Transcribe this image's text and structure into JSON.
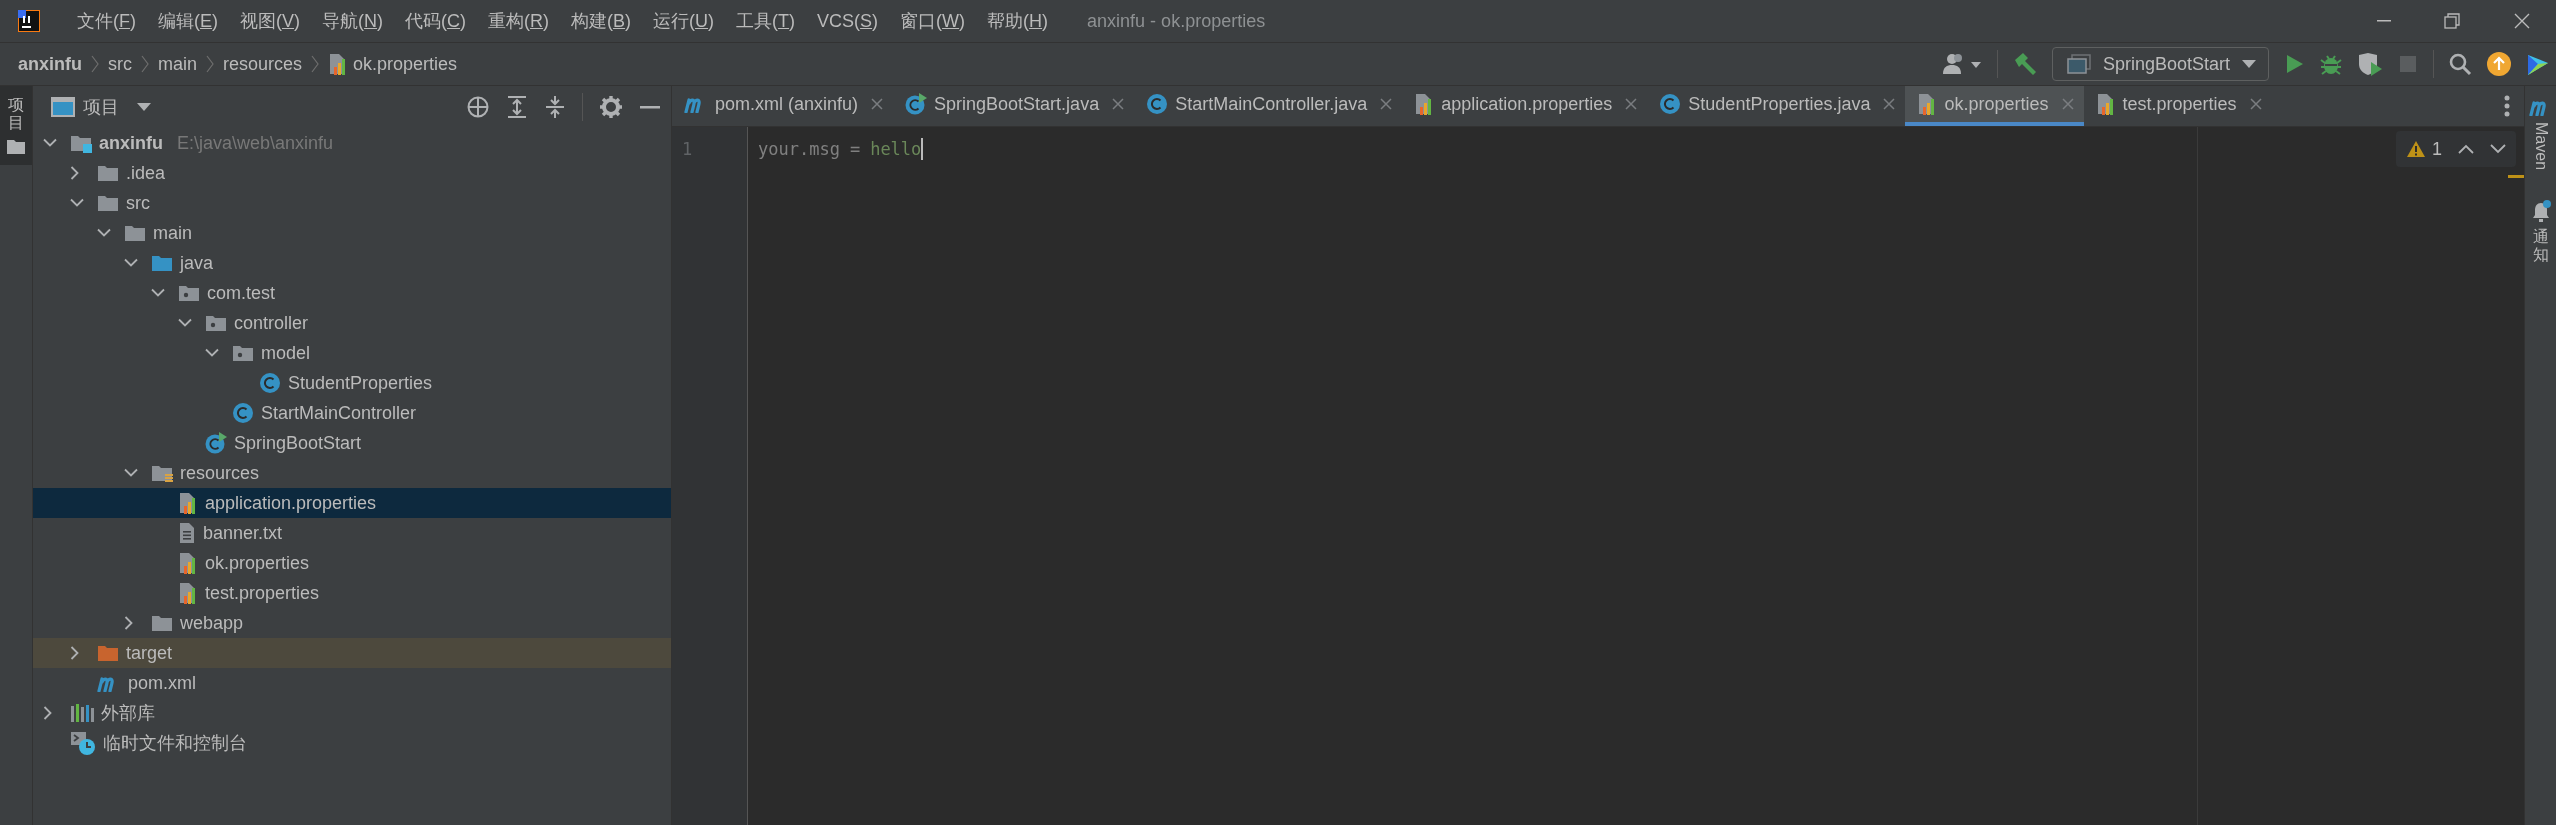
{
  "window": {
    "title": "anxinfu - ok.properties"
  },
  "menu": [
    "文件(F)",
    "编辑(E)",
    "视图(V)",
    "导航(N)",
    "代码(C)",
    "重构(R)",
    "构建(B)",
    "运行(U)",
    "工具(T)",
    "VCS(S)",
    "窗口(W)",
    "帮助(H)"
  ],
  "breadcrumbs": [
    {
      "label": "anxinfu",
      "kind": "project"
    },
    {
      "label": "src",
      "kind": "dir"
    },
    {
      "label": "main",
      "kind": "dir"
    },
    {
      "label": "resources",
      "kind": "dir"
    },
    {
      "label": "ok.properties",
      "kind": "properties"
    }
  ],
  "run_configuration": "SpringBootStart",
  "left_tool_strip": [
    {
      "label": "项目",
      "selected": true
    }
  ],
  "project_panel": {
    "title": "项目",
    "tree": [
      {
        "label": "anxinfu",
        "detail": "E:\\java\\web\\anxinfu",
        "kind": "module",
        "expanded": true,
        "selected": false,
        "children": [
          {
            "label": ".idea",
            "kind": "folder",
            "expanded": false,
            "selected": false
          },
          {
            "label": "src",
            "kind": "folder",
            "expanded": true,
            "selected": false,
            "children": [
              {
                "label": "main",
                "kind": "folder",
                "expanded": true,
                "selected": false,
                "children": [
                  {
                    "label": "java",
                    "kind": "source-folder",
                    "expanded": true,
                    "selected": false,
                    "children": [
                      {
                        "label": "com.test",
                        "kind": "package",
                        "expanded": true,
                        "selected": false,
                        "children": [
                          {
                            "label": "controller",
                            "kind": "package",
                            "expanded": true,
                            "selected": false,
                            "children": [
                              {
                                "label": "model",
                                "kind": "package",
                                "expanded": true,
                                "selected": false,
                                "children": [
                                  {
                                    "label": "StudentProperties",
                                    "kind": "class",
                                    "selected": false
                                  }
                                ]
                              },
                              {
                                "label": "StartMainController",
                                "kind": "class",
                                "selected": false
                              }
                            ]
                          },
                          {
                            "label": "SpringBootStart",
                            "kind": "main-class",
                            "selected": false
                          }
                        ]
                      }
                    ]
                  },
                  {
                    "label": "resources",
                    "kind": "resources-folder",
                    "expanded": true,
                    "selected": false,
                    "children": [
                      {
                        "label": "application.properties",
                        "kind": "properties",
                        "selected": true
                      },
                      {
                        "label": "banner.txt",
                        "kind": "text",
                        "selected": false
                      },
                      {
                        "label": "ok.properties",
                        "kind": "properties",
                        "selected": false
                      },
                      {
                        "label": "test.properties",
                        "kind": "properties",
                        "selected": false
                      }
                    ]
                  },
                  {
                    "label": "webapp",
                    "kind": "folder",
                    "expanded": false,
                    "selected": false
                  }
                ]
              }
            ]
          },
          {
            "label": "target",
            "kind": "excluded-folder",
            "expanded": false,
            "selected": false
          },
          {
            "label": "pom.xml",
            "kind": "maven",
            "selected": false
          }
        ]
      },
      {
        "label": "外部库",
        "kind": "libraries",
        "expanded": false,
        "selected": false
      },
      {
        "label": "临时文件和控制台",
        "kind": "scratches",
        "selected": false
      }
    ]
  },
  "editor_tabs": [
    {
      "label": "pom.xml (anxinfu)",
      "kind": "maven",
      "selected": false
    },
    {
      "label": "SpringBootStart.java",
      "kind": "main-class",
      "selected": false
    },
    {
      "label": "StartMainController.java",
      "kind": "class",
      "selected": false
    },
    {
      "label": "application.properties",
      "kind": "properties",
      "selected": false
    },
    {
      "label": "StudentProperties.java",
      "kind": "class",
      "selected": false
    },
    {
      "label": "ok.properties",
      "kind": "properties",
      "selected": true
    },
    {
      "label": "test.properties",
      "kind": "properties",
      "selected": false
    }
  ],
  "editor": {
    "lines": [
      {
        "number": "1",
        "key": "your.msg",
        "separator": "=",
        "value": "hello"
      }
    ],
    "warnings": "1"
  },
  "right_tool_strip": [
    {
      "label": "Maven",
      "kind": "maven"
    },
    {
      "label": "通知",
      "kind": "notifications"
    }
  ]
}
